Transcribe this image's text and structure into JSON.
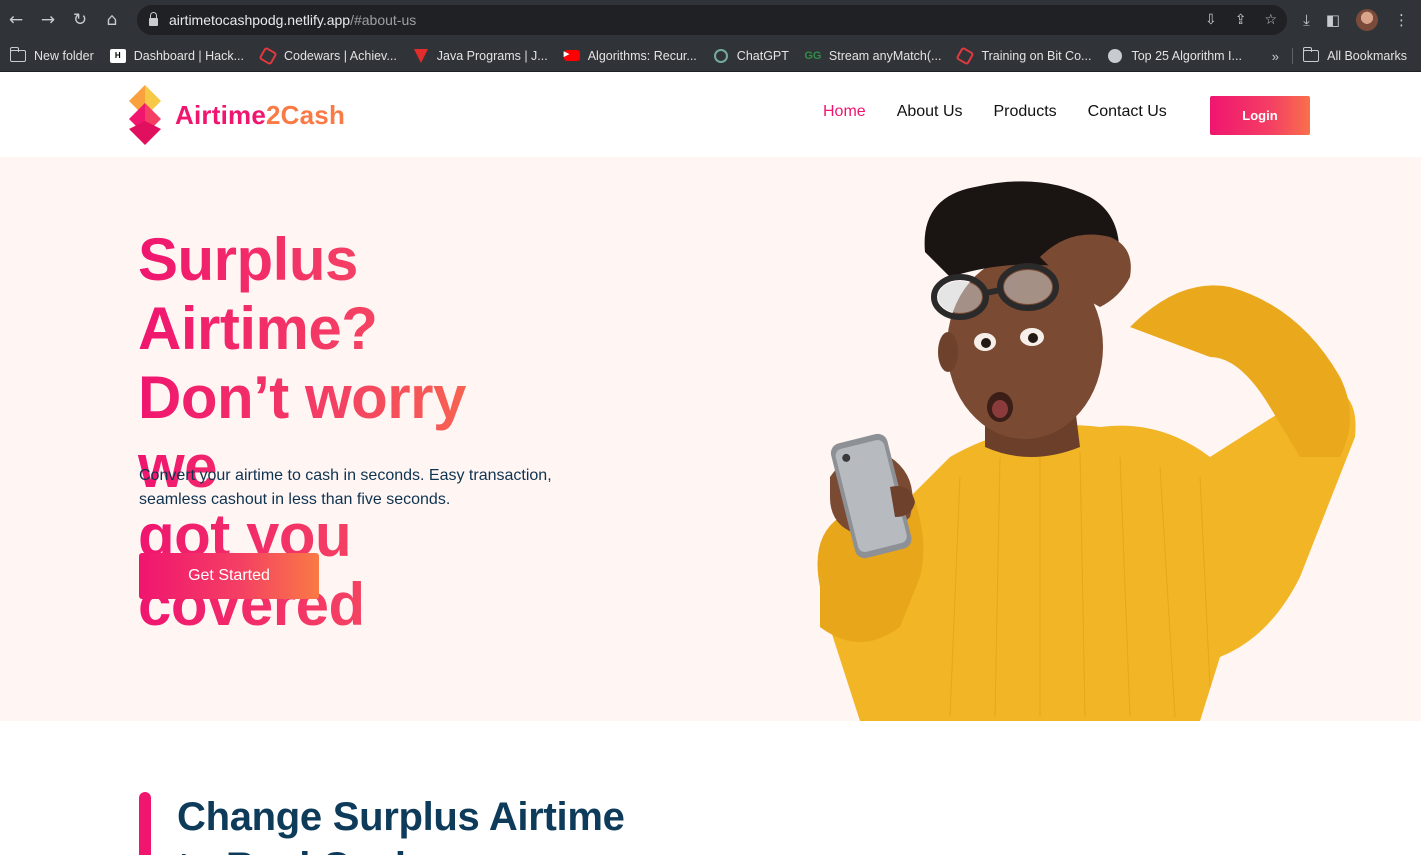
{
  "browser": {
    "url_host": "airtimetocashpodg.netlify.app",
    "url_path": "/#about-us",
    "nav": [
      "back-icon",
      "forward-icon",
      "reload-icon",
      "home-icon"
    ],
    "bookmarks": [
      {
        "label": "New folder",
        "icon": "folder-icon"
      },
      {
        "label": "Dashboard | Hack...",
        "icon": "hackerrank-icon"
      },
      {
        "label": "Codewars | Achiev...",
        "icon": "codewars-icon"
      },
      {
        "label": "Java Programs | J...",
        "icon": "java-icon"
      },
      {
        "label": "Algorithms: Recur...",
        "icon": "youtube-icon"
      },
      {
        "label": "ChatGPT",
        "icon": "chatgpt-icon"
      },
      {
        "label": "Stream anyMatch(...",
        "icon": "gfg-icon"
      },
      {
        "label": "Training on Bit Co...",
        "icon": "codewars-icon"
      },
      {
        "label": "Top 25 Algorithm I...",
        "icon": "globe-icon"
      }
    ],
    "bookmarks_more": "»",
    "all_bookmarks": "All Bookmarks"
  },
  "site": {
    "logo_part1": "Airtime",
    "logo_part2": "2Cash",
    "nav": {
      "home": "Home",
      "about": "About Us",
      "products": "Products",
      "contact": "Contact Us"
    },
    "login": "Login"
  },
  "hero": {
    "title_line1": "Surplus Airtime?",
    "title_line2": "Don’t worry we",
    "title_line3": "got you covered",
    "description": "Convert your airtime to cash in seconds. Easy transaction, seamless cashout in less than five seconds.",
    "cta": "Get Started"
  },
  "section": {
    "title_line1": "Change Surplus Airtime",
    "title_line2": "to Real Cash"
  },
  "colors": {
    "brand_pink": "#f0156f",
    "brand_orange": "#f97a45",
    "hero_bg": "#fff6f4",
    "navy": "#0e3b5a",
    "sweater": "#f2b526"
  }
}
